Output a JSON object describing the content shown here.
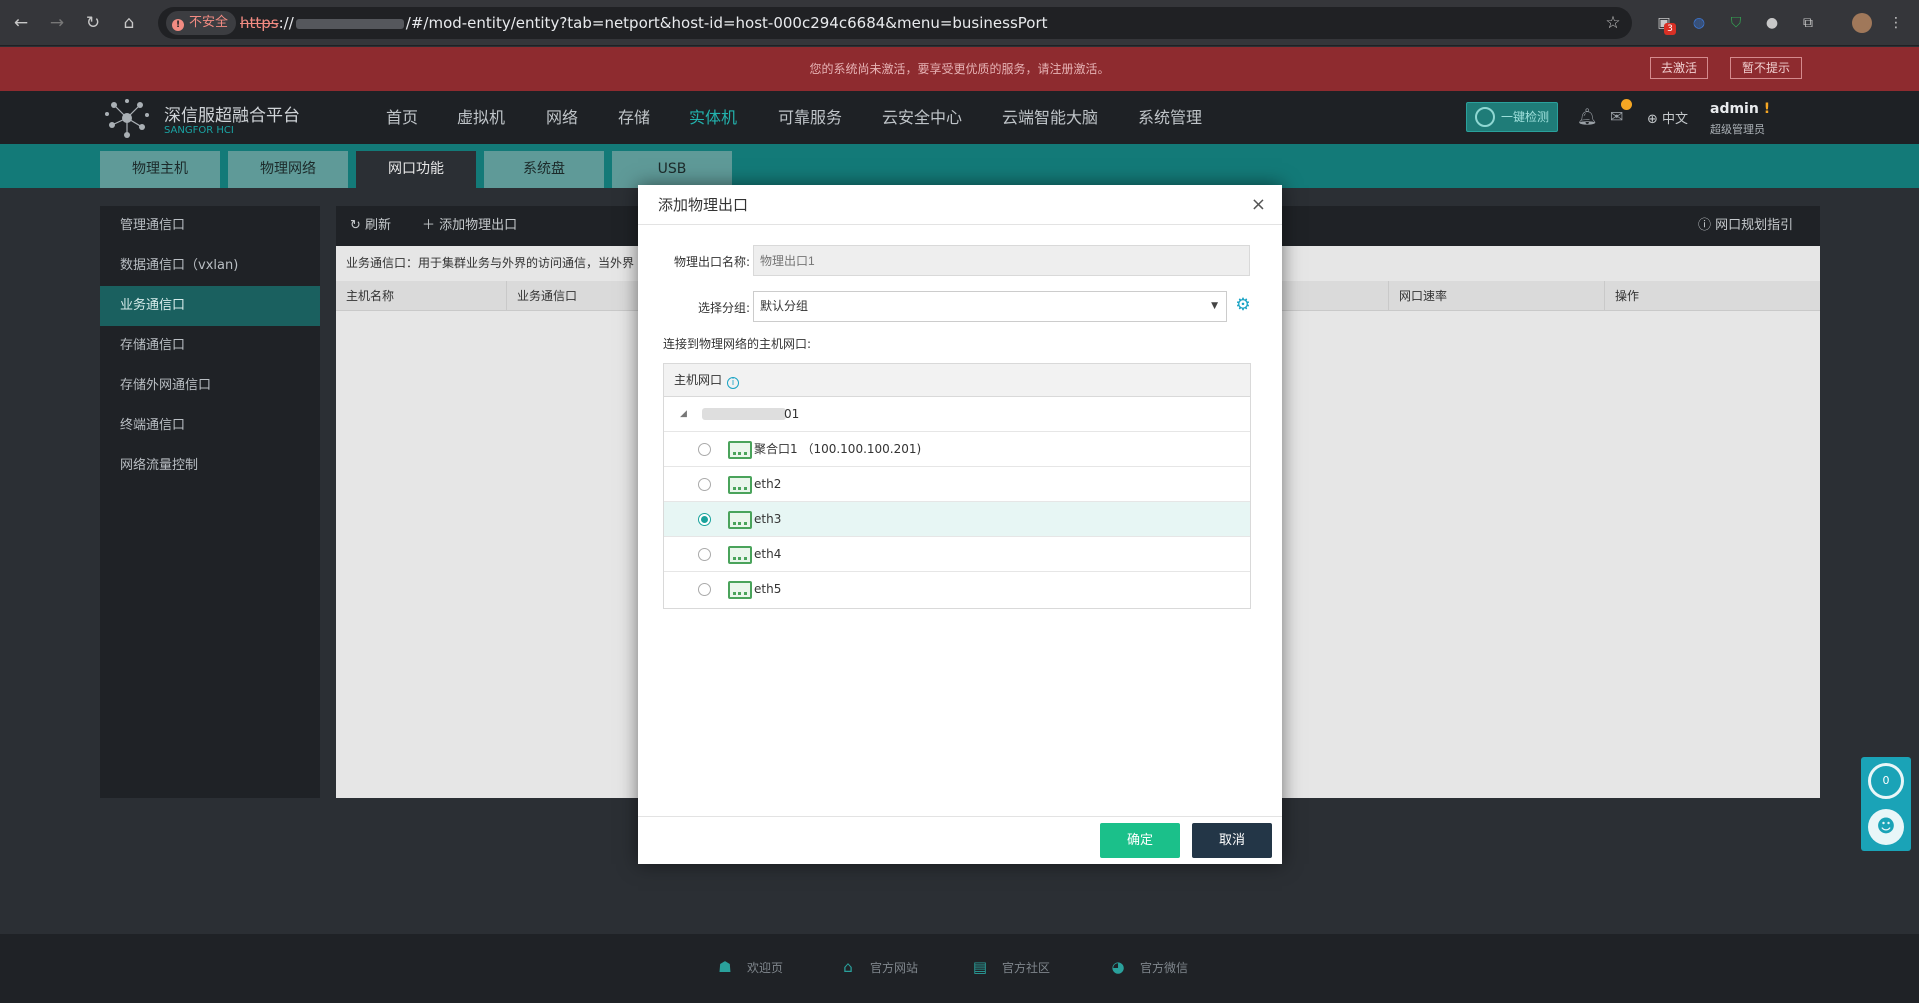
{
  "browser": {
    "insecure_label": "不安全",
    "url_scheme": "https",
    "url_sep": "://",
    "url_path": "/#/mod-entity/entity?tab=netport&host-id=host-000c294c6684&menu=businessPort",
    "ext_badge": "3"
  },
  "banner": {
    "text": "您的系统尚未激活，要享受更优质的服务，请注册激活。",
    "activate": "去激活",
    "dismiss": "暂不提示"
  },
  "topnav": {
    "brand": "深信服超融合平台",
    "brand_sub": "SANGFOR HCI",
    "menus": [
      "首页",
      "虚拟机",
      "网络",
      "存储",
      "实体机",
      "可靠服务",
      "云安全中心",
      "云端智能大脑",
      "系统管理"
    ],
    "active_menu": "实体机",
    "quick_check": "一键检测",
    "lang": "中文",
    "user": "admin",
    "user_warn": "!",
    "role": "超级管理员"
  },
  "subtabs": [
    "物理主机",
    "物理网络",
    "网口功能",
    "系统盘",
    "USB"
  ],
  "active_subtab": "网口功能",
  "sidebar": [
    "管理通信口",
    "数据通信口（vxlan)",
    "业务通信口",
    "存储通信口",
    "存储外网通信口",
    "终端通信口",
    "网络流量控制"
  ],
  "active_sidebar": "业务通信口",
  "toolbar": {
    "refresh": "刷新",
    "add": "添加物理出口",
    "guide": "网口规划指引"
  },
  "main": {
    "description": "业务通信口：用于集群业务与外界的访问通信，当外界",
    "columns": [
      "主机名称",
      "业务通信口",
      "网口速率",
      "操作"
    ]
  },
  "dialog": {
    "title": "添加物理出口",
    "name_label": "物理出口名称:",
    "name_placeholder": "物理出口1",
    "group_label": "选择分组:",
    "group_value": "默认分组",
    "connect_label": "连接到物理网络的主机网口:",
    "tree_header": "主机网口",
    "host_suffix": "01",
    "ports": [
      {
        "label": "聚合口1 （100.100.100.201)",
        "selected": false
      },
      {
        "label": "eth2",
        "selected": false
      },
      {
        "label": "eth3",
        "selected": true
      },
      {
        "label": "eth4",
        "selected": false
      },
      {
        "label": "eth5",
        "selected": false
      }
    ],
    "ok": "确定",
    "cancel": "取消"
  },
  "float_widget": {
    "count": "0"
  },
  "footer": [
    "欢迎页",
    "官方网站",
    "官方社区",
    "官方微信"
  ],
  "colors": {
    "accent": "#23b3ae",
    "banner": "#8e2b2f",
    "ok": "#1bc08a",
    "cancel": "#233647"
  }
}
